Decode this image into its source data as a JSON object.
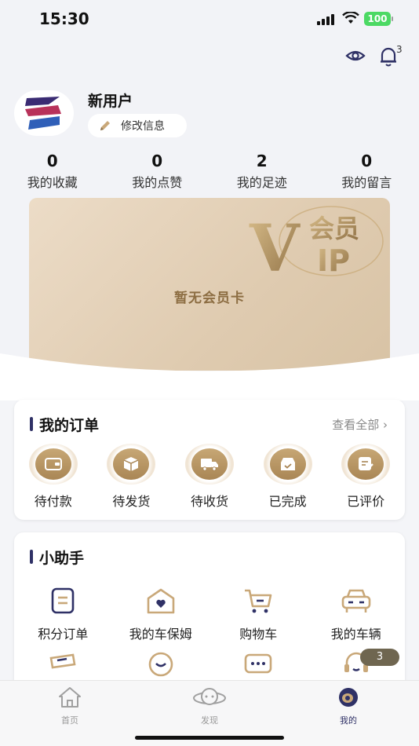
{
  "status_bar": {
    "time": "15:30",
    "battery": "100"
  },
  "header": {
    "notification_count": "3"
  },
  "profile": {
    "username": "新用户",
    "edit_label": "修改信息"
  },
  "stats": [
    {
      "value": "0",
      "label": "我的收藏"
    },
    {
      "value": "0",
      "label": "我的点赞"
    },
    {
      "value": "2",
      "label": "我的足迹"
    },
    {
      "value": "0",
      "label": "我的留言"
    }
  ],
  "vip_card": {
    "logo_text_top": "会员",
    "logo_text_bottom": "IP",
    "logo_letter": "V",
    "message": "暂无会员卡"
  },
  "orders": {
    "title": "我的订单",
    "view_all": "查看全部 ›",
    "items": [
      {
        "label": "待付款",
        "icon": "wallet-icon"
      },
      {
        "label": "待发货",
        "icon": "box-icon"
      },
      {
        "label": "待收货",
        "icon": "truck-icon"
      },
      {
        "label": "已完成",
        "icon": "tray-check-icon"
      },
      {
        "label": "已评价",
        "icon": "review-icon"
      }
    ]
  },
  "helper": {
    "title": "小助手",
    "items": [
      {
        "label": "积分订单",
        "icon": "points-order-icon"
      },
      {
        "label": "我的车保姆",
        "icon": "car-nanny-icon"
      },
      {
        "label": "购物车",
        "icon": "cart-icon"
      },
      {
        "label": "我的车辆",
        "icon": "car-icon"
      },
      {
        "label": "",
        "icon": "coupon-icon"
      },
      {
        "label": "",
        "icon": "smile-icon"
      },
      {
        "label": "",
        "icon": "chat-icon"
      },
      {
        "label": "",
        "icon": "service-icon"
      }
    ],
    "badge": "3"
  },
  "tabs": [
    {
      "label": "首页",
      "icon": "home-icon"
    },
    {
      "label": "发现",
      "icon": "planet-icon"
    },
    {
      "label": "我的",
      "icon": "profile-eye-icon"
    }
  ],
  "colors": {
    "accent": "#2f3166",
    "gold": "#a98655",
    "vip_bg": "#e4d2b9"
  }
}
